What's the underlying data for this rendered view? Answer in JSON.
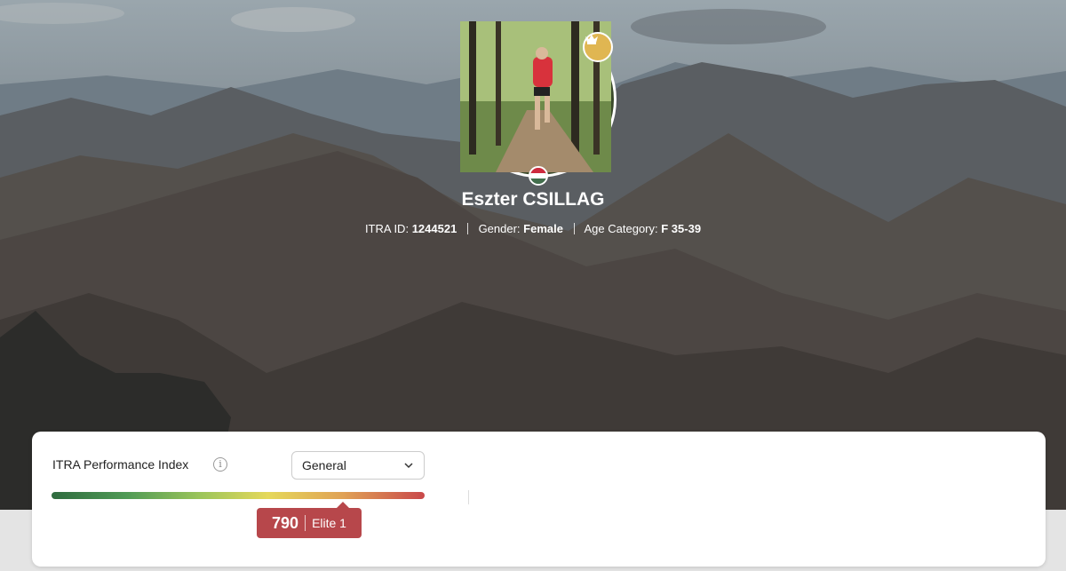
{
  "profile": {
    "name": "Eszter CSILLAG",
    "itra_id_label": "ITRA ID:",
    "itra_id": "1244521",
    "gender_label": "Gender:",
    "gender": "Female",
    "age_category_label": "Age Category:",
    "age_category": "F 35-39",
    "flag_colors": [
      "#cd2a3e",
      "#ffffff",
      "#436f4d"
    ],
    "badge_icon": "crown-icon"
  },
  "performance": {
    "label": "ITRA Performance Index",
    "info_icon": "info-icon",
    "select_value": "General",
    "score": "790",
    "level": "Elite 1",
    "score_fraction": 0.787
  },
  "colors": {
    "score_badge": "#b7474b",
    "crown_badge": "#e0b652"
  }
}
